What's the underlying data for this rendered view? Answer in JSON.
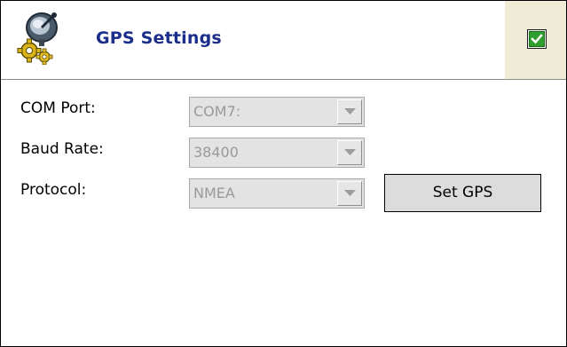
{
  "header": {
    "title": "GPS Settings",
    "icon": "gps-settings-icon",
    "ok_icon": "checkmark-icon"
  },
  "form": {
    "com_port": {
      "label": "COM Port:",
      "value": "COM7:"
    },
    "baud_rate": {
      "label": "Baud Rate:",
      "value": "38400"
    },
    "protocol": {
      "label": "Protocol:",
      "value": "NMEA"
    }
  },
  "actions": {
    "set_gps_label": "Set GPS"
  },
  "colors": {
    "title": "#1b2e8c",
    "ok_area": "#efebd6",
    "check": "#1a8a1a",
    "disabled_text": "#9a9a9a"
  }
}
